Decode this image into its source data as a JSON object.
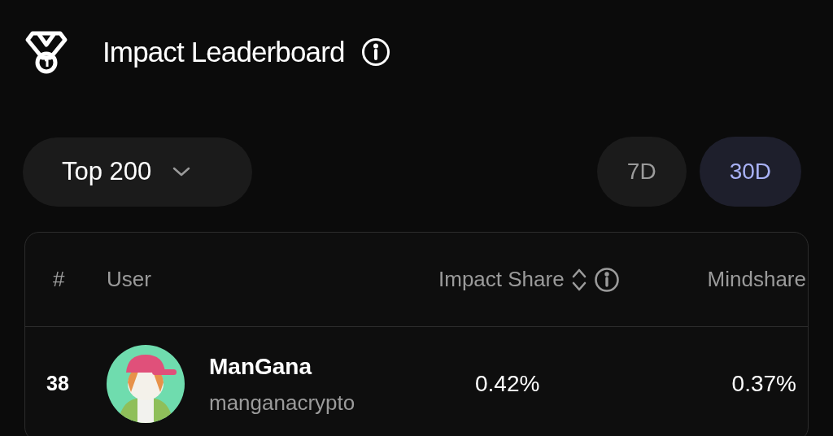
{
  "header": {
    "title": "Impact Leaderboard"
  },
  "filter": {
    "label": "Top 200"
  },
  "periods": [
    {
      "label": "7D",
      "selected": false
    },
    {
      "label": "30D",
      "selected": true
    }
  ],
  "table": {
    "columns": [
      {
        "label": "#",
        "sortable": false,
        "info": false
      },
      {
        "label": "User",
        "sortable": false,
        "info": false
      },
      {
        "label": "Impact Share",
        "sortable": true,
        "info": true
      },
      {
        "label": "Mindshare",
        "sortable": false,
        "info": false
      }
    ],
    "rows": [
      {
        "rank": "38",
        "name": "ManGana",
        "handle": "manganacrypto",
        "impact_share": "0.42%",
        "mindshare": "0.37%"
      }
    ]
  }
}
